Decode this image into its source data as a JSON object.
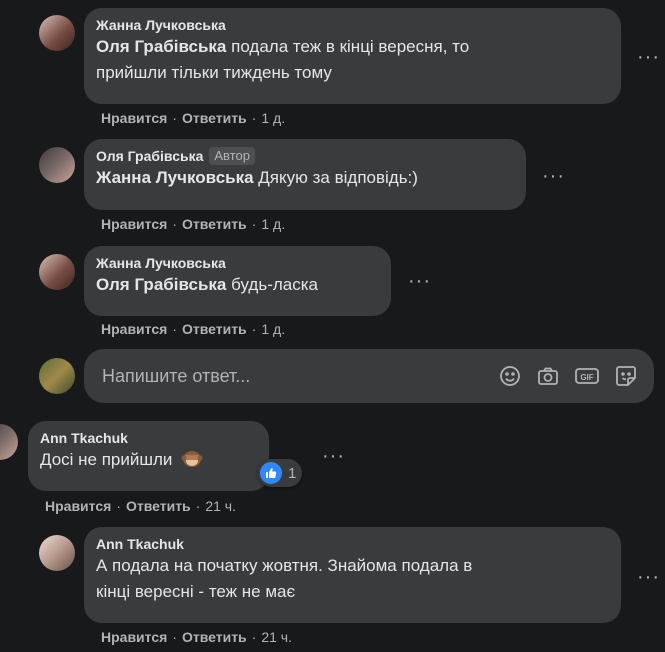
{
  "comments": [
    {
      "author": "Жанна Лучковська",
      "mention": "Оля Грабівська",
      "line1": "подала теж в кінці вересня, то",
      "line2": "прийшли тільки тиждень тому",
      "like": "Нравится",
      "reply": "Ответить",
      "time": "1 д."
    },
    {
      "author": "Оля Грабівська",
      "badge": "Автор",
      "mention": "Жанна Лучковська",
      "text": "Дякую за відповідь:)",
      "like": "Нравится",
      "reply": "Ответить",
      "time": "1 д."
    },
    {
      "author": "Жанна Лучковська",
      "mention": "Оля Грабівська",
      "text": "будь-ласка",
      "like": "Нравится",
      "reply": "Ответить",
      "time": "1 д."
    },
    {
      "author": "Ann Tkachuk",
      "text": "Досі не прийшли",
      "emoji_icon": "see-no-evil-monkey-icon",
      "reaction_count": "1",
      "like": "Нравится",
      "reply": "Ответить",
      "time": "21 ч."
    },
    {
      "author": "Ann Tkachuk",
      "line1": "А подала на початку жовтня. Знайома подала в",
      "line2": "кінці вересні - теж не має",
      "like": "Нравится",
      "reply": "Ответить",
      "time": "21 ч."
    }
  ],
  "reply_box": {
    "placeholder": "Напишите ответ...",
    "icons": [
      "emoji-icon",
      "camera-icon",
      "gif-icon",
      "sticker-icon"
    ]
  },
  "separator": "·",
  "colors": {
    "background": "#18191a",
    "bubble": "#3a3b3c",
    "secondary_text": "#b0b3b8",
    "like_blue": "#2e89ff"
  }
}
